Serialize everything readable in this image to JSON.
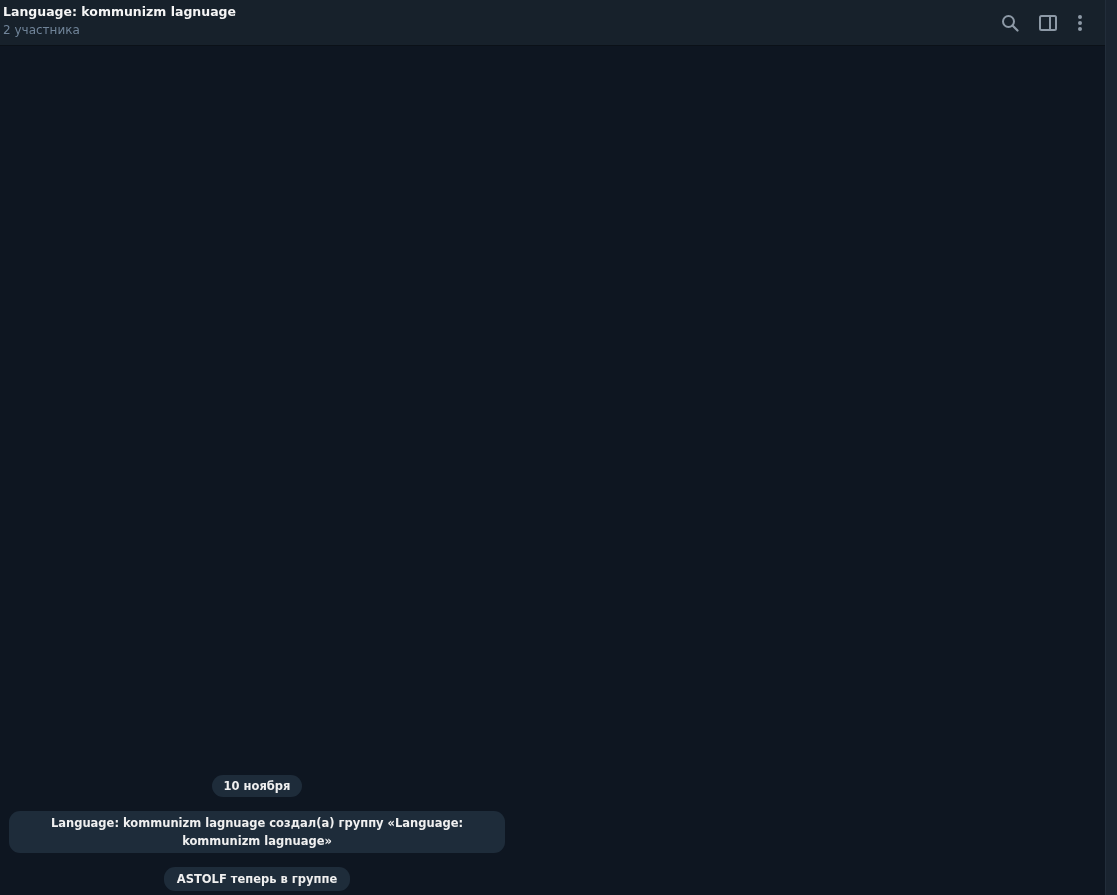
{
  "header": {
    "title": "Language: kommunizm lagnuage",
    "subtitle": "2 участника"
  },
  "messages": [
    {
      "kind": "date",
      "text": "10 ноября"
    },
    {
      "kind": "service",
      "text": "Language: kommunizm lagnuage создал(а) группу «Language: kommunizm lagnuage»"
    },
    {
      "kind": "service",
      "text": "ASTOLF теперь в группе"
    }
  ]
}
